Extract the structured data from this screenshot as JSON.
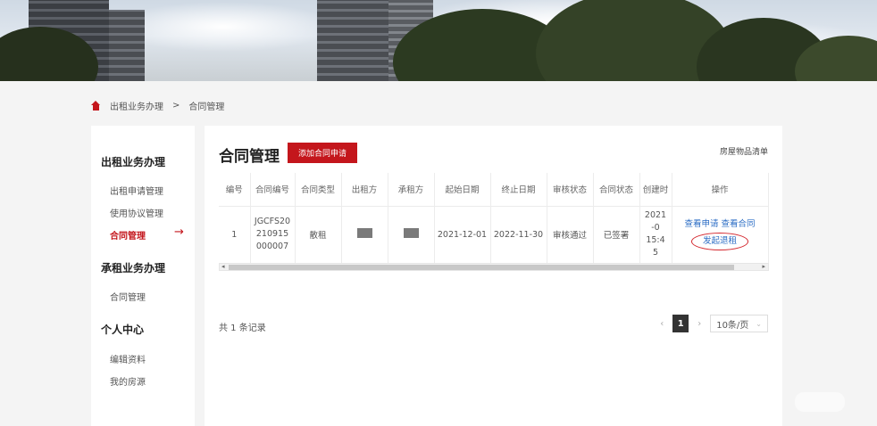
{
  "breadcrumb": {
    "section": "出租业务办理",
    "separator": ">",
    "current": "合同管理"
  },
  "sidebar": {
    "groups": [
      {
        "title": "出租业务办理",
        "items": [
          "出租申请管理",
          "使用协议管理",
          "合同管理"
        ]
      },
      {
        "title": "承租业务办理",
        "items": [
          "合同管理"
        ]
      },
      {
        "title": "个人中心",
        "items": [
          "编辑资料",
          "我的房源"
        ]
      }
    ],
    "active_arrow": "→"
  },
  "main": {
    "title": "合同管理",
    "add_button": "添加合同申请",
    "inventory_link": "房屋物品清单",
    "table": {
      "headers": [
        "编号",
        "合同编号",
        "合同类型",
        "出租方",
        "承租方",
        "起始日期",
        "终止日期",
        "审核状态",
        "合同状态",
        "创建时",
        "操作"
      ],
      "row": {
        "index": "1",
        "contract_no": "JGCFS20210915000007",
        "type": "散租",
        "start": "2021-12-01",
        "end": "2022-11-30",
        "audit_status": "审核通过",
        "contract_status": "已签署",
        "created": "2021-0",
        "created_time": "15:45",
        "op_view_apply": "查看申请",
        "op_view_contract": "查看合同",
        "op_terminate": "发起退租"
      }
    },
    "scroll": {
      "left": "◂",
      "right": "▸"
    }
  },
  "pagination": {
    "total": "共 1 条记录",
    "prev": "‹",
    "current_page": "1",
    "next": "›",
    "page_size": "10条/页",
    "chevron": "⌄"
  },
  "colors": {
    "accent": "#c4161c",
    "link": "#2b6cc4"
  }
}
